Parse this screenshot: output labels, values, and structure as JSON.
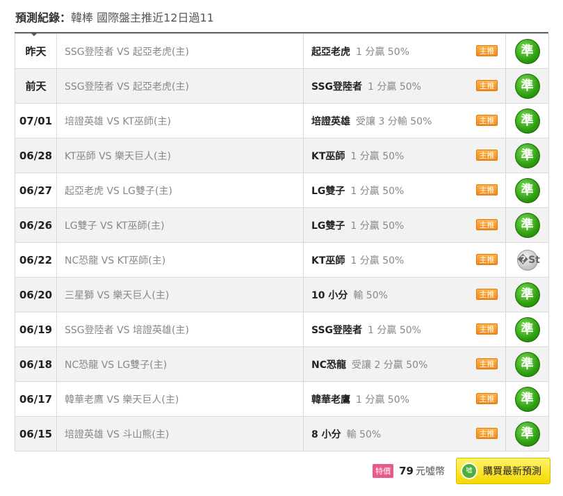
{
  "header": {
    "label": "預測紀錄：",
    "subtitle": "韓棒 國際盤主推近12日過11"
  },
  "rows": [
    {
      "date": "昨天",
      "match": "SSG登陸者 VS 起亞老虎(主)",
      "team": "起亞老虎",
      "odds": "1 分贏 50%",
      "badge": "主推",
      "result": "準",
      "status": "win"
    },
    {
      "date": "前天",
      "match": "SSG登陸者 VS 起亞老虎(主)",
      "team": "SSG登陸者",
      "odds": "1 分贏 50%",
      "badge": "主推",
      "result": "準",
      "status": "win"
    },
    {
      "date": "07/01",
      "match": "培證英雄 VS KT巫師(主)",
      "team": "培證英雄",
      "odds": "受讓 3 分輸 50%",
      "badge": "主推",
      "result": "準",
      "status": "win"
    },
    {
      "date": "06/28",
      "match": "KT巫師 VS 樂天巨人(主)",
      "team": "KT巫師",
      "odds": "1 分贏 50%",
      "badge": "主推",
      "result": "準",
      "status": "win"
    },
    {
      "date": "06/27",
      "match": "起亞老虎 VS LG雙子(主)",
      "team": "LG雙子",
      "odds": "1 分贏 50%",
      "badge": "主推",
      "result": "準",
      "status": "win"
    },
    {
      "date": "06/26",
      "match": "LG雙子 VS KT巫師(主)",
      "team": "LG雙子",
      "odds": "1 分贏 50%",
      "badge": "主推",
      "result": "準",
      "status": "win"
    },
    {
      "date": "06/22",
      "match": "NC恐龍 VS KT巫師(主)",
      "team": "KT巫師",
      "odds": "1 分贏 50%",
      "badge": "主推",
      "result": "�St",
      "status": "push"
    },
    {
      "date": "06/20",
      "match": "三星獅 VS 樂天巨人(主)",
      "team": "10 小分",
      "odds": "輸 50%",
      "badge": "主推",
      "result": "準",
      "status": "win"
    },
    {
      "date": "06/19",
      "match": "SSG登陸者 VS 培證英雄(主)",
      "team": "SSG登陸者",
      "odds": "1 分贏 50%",
      "badge": "主推",
      "result": "準",
      "status": "win"
    },
    {
      "date": "06/18",
      "match": "NC恐龍 VS LG雙子(主)",
      "team": "NC恐龍",
      "odds": "受讓 2 分贏 50%",
      "badge": "主推",
      "result": "準",
      "status": "win"
    },
    {
      "date": "06/17",
      "match": "韓華老鷹 VS 樂天巨人(主)",
      "team": "韓華老鷹",
      "odds": "1 分贏 50%",
      "badge": "主推",
      "result": "準",
      "status": "win"
    },
    {
      "date": "06/15",
      "match": "培證英雄 VS 斗山熊(主)",
      "team": "8 小分",
      "odds": "輸 50%",
      "badge": "主推",
      "result": "準",
      "status": "win"
    }
  ],
  "footer": {
    "special": "特價",
    "price": "79",
    "unit": "元噓幣",
    "coin_text": "噓",
    "buy_label": "購買最新預測"
  },
  "colors": {
    "win": "#2e9e10",
    "push": "#c8c8c8",
    "badge": "#f08a1a",
    "buy": "#f6d800"
  }
}
